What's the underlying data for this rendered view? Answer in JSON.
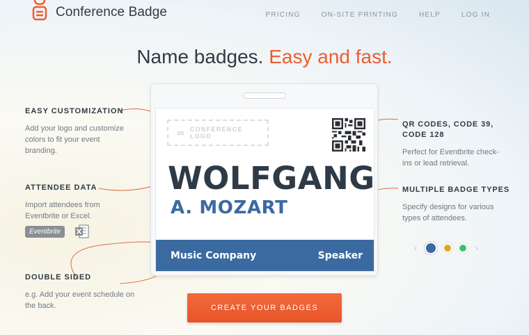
{
  "header": {
    "app_name": "Conference Badge",
    "nav": [
      "PRICING",
      "ON-SITE PRINTING",
      "HELP",
      "LOG IN"
    ]
  },
  "hero": {
    "headline_main": "Name badges.",
    "headline_accent": "Easy and fast."
  },
  "badge": {
    "logo_placeholder": "CONFERENCE LOGO",
    "first_name": "WOLFGANG",
    "last_name": "A. MOZART",
    "company": "Music Company",
    "role": "Speaker"
  },
  "features": {
    "easy": {
      "title": "EASY CUSTOMIZATION",
      "text": "Add your logo and customize colors to fit your event branding."
    },
    "attendee": {
      "title": "ATTENDEE DATA",
      "text": "Import attendees from Eventbrite or Excel."
    },
    "double": {
      "title": "DOUBLE SIDED",
      "text": "e.g. Add your event schedule on the back."
    },
    "qr": {
      "title": "QR CODES, CODE 39, CODE 128",
      "text": "Perfect for Eventbrite check-ins or lead retrieval."
    },
    "multi": {
      "title": "MULTIPLE BADGE TYPES",
      "text": "Specify designs for various types of attendees."
    }
  },
  "integrations": {
    "eventbrite": "Eventbrite",
    "excel_icon": "excel-icon"
  },
  "badge_type_dots": {
    "colors": [
      "#3b6aa0",
      "#e0a81c",
      "#3fbd72"
    ],
    "active_index": 0
  },
  "cta": {
    "label": "CREATE YOUR BADGES"
  },
  "colors": {
    "accent": "#ec5d32",
    "badge_blue": "#3b6aa0",
    "heading": "#2e3a45"
  }
}
